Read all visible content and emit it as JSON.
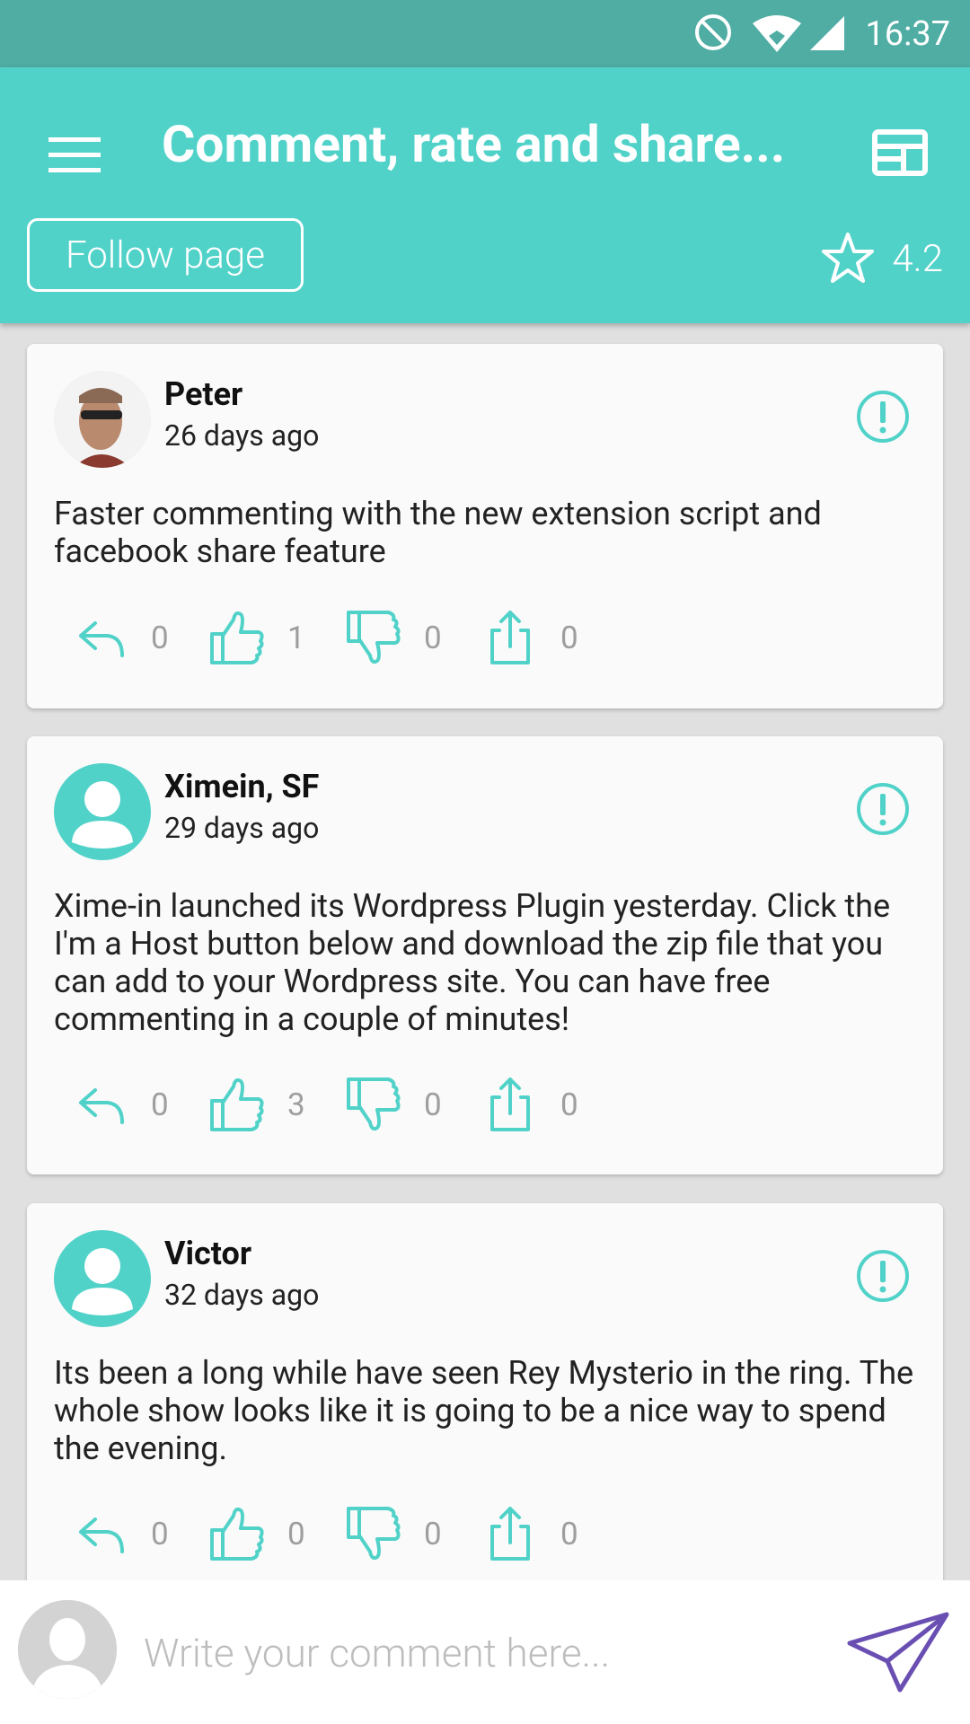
{
  "status_bar": {
    "time": "16:37"
  },
  "header": {
    "title": "Comment, rate and share...",
    "follow_label": "Follow page",
    "rating": "4.2"
  },
  "comments": [
    {
      "author": "Peter",
      "time_ago": "26 days ago",
      "text": "Faster commenting with the new extension script and facebook share feature",
      "avatar": "photo",
      "replies": "0",
      "likes": "1",
      "dislikes": "0",
      "shares": "0"
    },
    {
      "author": "Ximein, SF",
      "time_ago": "29 days ago",
      "text": "Xime-in launched its Wordpress Plugin yesterday. Click the I'm a Host button below and download the zip file that you can add to your Wordpress site. You can have free commenting in a couple of minutes!",
      "avatar": "default-user",
      "replies": "0",
      "likes": "3",
      "dislikes": "0",
      "shares": "0"
    },
    {
      "author": "Victor",
      "time_ago": "32 days ago",
      "text": "Its been a long while have seen Rey Mysterio in the ring. The whole show looks like it is going to be a nice way to spend the evening.",
      "avatar": "default-user",
      "replies": "0",
      "likes": "0",
      "dislikes": "0",
      "shares": "0"
    }
  ],
  "composer": {
    "placeholder": "Write your comment here..."
  },
  "colors": {
    "status_bar": "#4fada3",
    "primary": "#51d2c9",
    "send": "#6a4fb3",
    "count": "#9e9e9e"
  },
  "icons": [
    "menu-icon",
    "layout-icon",
    "star-icon",
    "report-icon",
    "reply-icon",
    "thumbs-up-icon",
    "thumbs-down-icon",
    "share-icon",
    "send-icon"
  ]
}
